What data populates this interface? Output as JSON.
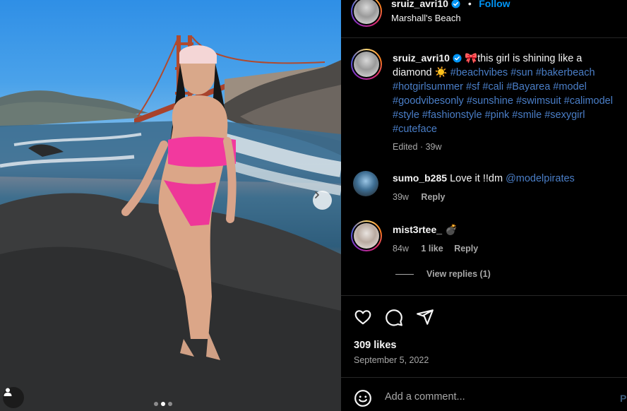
{
  "post": {
    "author": "sruiz_avri10",
    "follow_label": "Follow",
    "separator": "•",
    "location": "Marshall's Beach"
  },
  "caption": {
    "username": "sruiz_avri10",
    "text_emoji": "🎀",
    "text": "this girl is shining like a diamond",
    "text_emoji2": "☀️",
    "hashtags": [
      "#beachvibes",
      "#sun",
      "#bakerbeach",
      "#hotgirlsummer",
      "#sf",
      "#cali",
      "#Bayarea",
      "#model",
      "#goodvibesonly",
      "#sunshine",
      "#swimsuit",
      "#calimodel",
      "#style",
      "#fashionstyle",
      "#pink",
      "#smile",
      "#sexygirl",
      "#cuteface"
    ],
    "edited": "Edited",
    "dot": "·",
    "time": "39w"
  },
  "comments": [
    {
      "username": "sumo_b285",
      "text": "Love it !!dm",
      "mention": "@modelpirates",
      "time": "39w",
      "reply_label": "Reply"
    },
    {
      "username": "mist3rtee_",
      "text": "💣",
      "time": "84w",
      "likes": "1 like",
      "reply_label": "Reply",
      "view_replies": "View replies (1)"
    }
  ],
  "actions": {
    "like_icon": "heart-icon",
    "comment_icon": "comment-icon",
    "share_icon": "share-icon"
  },
  "likes": "309 likes",
  "date": "September 5, 2022",
  "add_comment": {
    "placeholder": "Add a comment...",
    "post_label": "P",
    "emoji_icon": "smile-icon"
  },
  "colors": {
    "background": "#000000",
    "accent": "#0095f6",
    "hashtag": "#4a7ec7",
    "muted": "#a8a8a8",
    "divider": "#262626"
  }
}
